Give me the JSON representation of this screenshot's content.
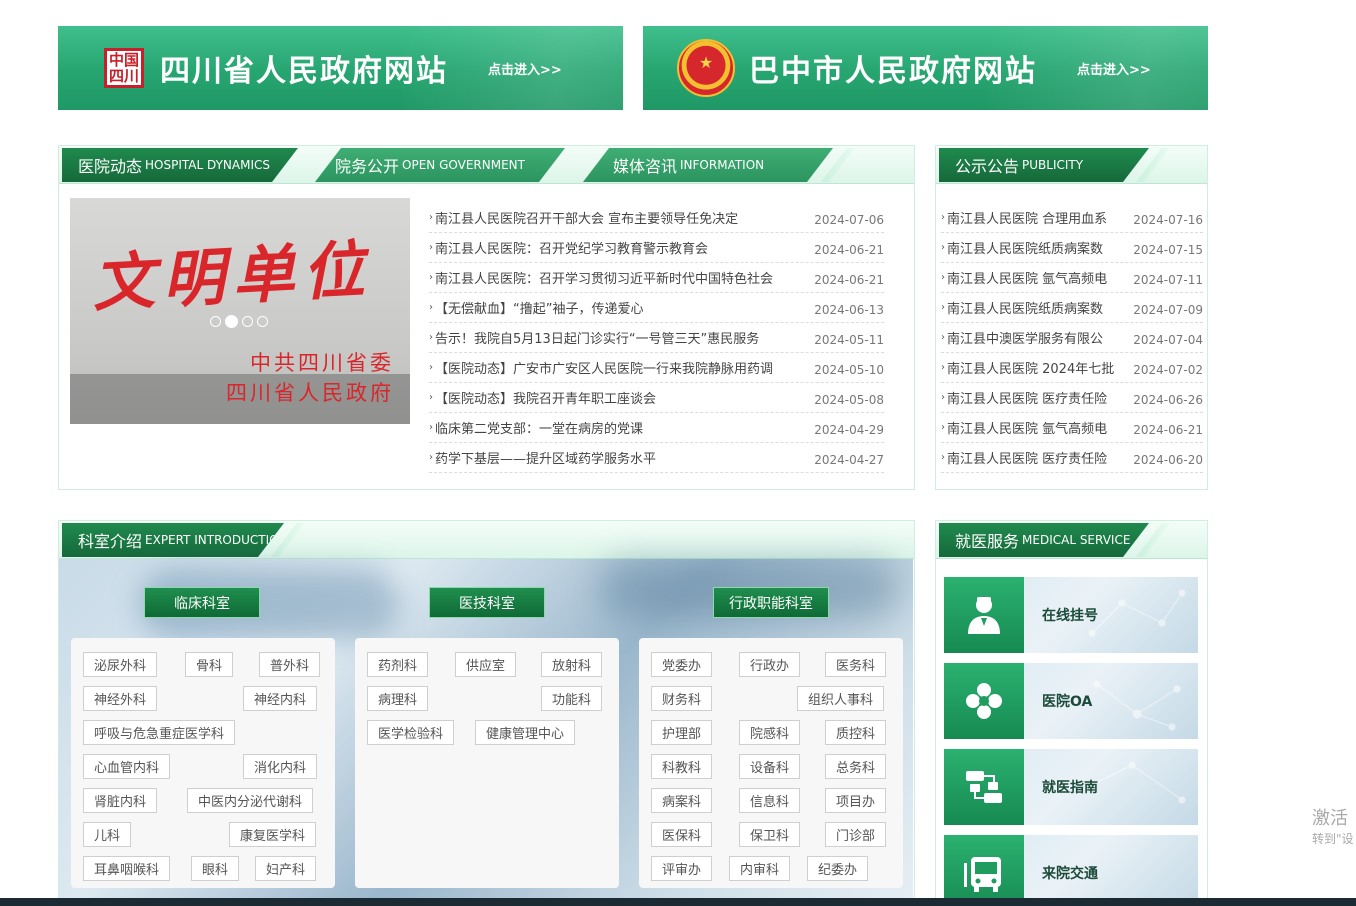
{
  "banners": [
    {
      "title": "四川省人民政府网站",
      "enter": "点击进入>>",
      "seal_text": "中国四川"
    },
    {
      "title": "巴中市人民政府网站",
      "enter": "点击进入>>",
      "emblem_icon": "national-emblem"
    }
  ],
  "news_panel": {
    "tabs": [
      {
        "cn": "医院动态",
        "en": "HOSPITAL DYNAMICS"
      },
      {
        "cn": "院务公开",
        "en": "OPEN GOVERNMENT"
      },
      {
        "cn": "媒体咨讯",
        "en": "INFORMATION"
      }
    ],
    "slide": {
      "big_text": "文明单位",
      "sub_line1": "中共四川省委",
      "sub_line2": "四川省人民政府",
      "active_dot": 2,
      "dot_count": 4
    },
    "items": [
      {
        "title": "南江县人民医院召开干部大会 宣布主要领导任免决定",
        "date": "2024-07-06"
      },
      {
        "title": "南江县人民医院：召开党纪学习教育警示教育会",
        "date": "2024-06-21"
      },
      {
        "title": "南江县人民医院：召开学习贯彻习近平新时代中国特色社会",
        "date": "2024-06-21"
      },
      {
        "title": "【无偿献血】“撸起”袖子，传递爱心",
        "date": "2024-06-13"
      },
      {
        "title": "告示！我院自5月13日起门诊实行“一号管三天”惠民服务",
        "date": "2024-05-11"
      },
      {
        "title": "【医院动态】广安市广安区人民医院一行来我院静脉用药调",
        "date": "2024-05-10"
      },
      {
        "title": "【医院动态】我院召开青年职工座谈会",
        "date": "2024-05-08"
      },
      {
        "title": "临床第二党支部：一堂在病房的党课",
        "date": "2024-04-29"
      },
      {
        "title": "药学下基层——提升区域药学服务水平",
        "date": "2024-04-27"
      }
    ]
  },
  "notice_panel": {
    "tab": {
      "cn": "公示公告",
      "en": "PUBLICITY"
    },
    "items": [
      {
        "title": "南江县人民医院 合理用血系",
        "date": "2024-07-16"
      },
      {
        "title": "南江县人民医院纸质病案数",
        "date": "2024-07-15"
      },
      {
        "title": "南江县人民医院 氩气高频电",
        "date": "2024-07-11"
      },
      {
        "title": "南江县人民医院纸质病案数",
        "date": "2024-07-09"
      },
      {
        "title": "南江县中澳医学服务有限公",
        "date": "2024-07-04"
      },
      {
        "title": "南江县人民医院 2024年七批",
        "date": "2024-07-02"
      },
      {
        "title": "南江县人民医院 医疗责任险",
        "date": "2024-06-26"
      },
      {
        "title": "南江县人民医院 氩气高频电",
        "date": "2024-06-21"
      },
      {
        "title": "南江县人民医院 医疗责任险",
        "date": "2024-06-20"
      }
    ]
  },
  "dept_panel": {
    "tab": {
      "cn": "科室介绍",
      "en": "EXPERT INTRODUCTION"
    },
    "categories": [
      "临床科室",
      "医技科室",
      "行政职能科室"
    ],
    "clinical": [
      "泌尿外科",
      "骨科",
      "普外科",
      "神经外科",
      "神经内科",
      "呼吸与危急重症医学科",
      "心血管内科",
      "消化内科",
      "肾脏内科",
      "中医内分泌代谢科",
      "儿科",
      "康复医学科",
      "耳鼻咽喉科",
      "眼科",
      "妇产科"
    ],
    "technical": [
      "药剂科",
      "供应室",
      "放射科",
      "病理科",
      "功能科",
      "医学检验科",
      "健康管理中心"
    ],
    "admin": [
      "党委办",
      "行政办",
      "医务科",
      "财务科",
      "组织人事科",
      "护理部",
      "院感科",
      "质控科",
      "科教科",
      "设备科",
      "总务科",
      "病案科",
      "信息科",
      "项目办",
      "医保科",
      "保卫科",
      "门诊部",
      "评审办",
      "内审科",
      "纪委办"
    ]
  },
  "service_panel": {
    "tab": {
      "cn": "就医服务",
      "en": "MEDICAL SERVICE"
    },
    "items": [
      {
        "label": "在线挂号",
        "icon": "doctor-icon"
      },
      {
        "label": "医院OA",
        "icon": "flower-icon"
      },
      {
        "label": "就医指南",
        "icon": "flow-icon"
      },
      {
        "label": "来院交通",
        "icon": "bus-icon"
      }
    ]
  },
  "watermark": {
    "line1": "激活",
    "line2": "转到\"设"
  }
}
